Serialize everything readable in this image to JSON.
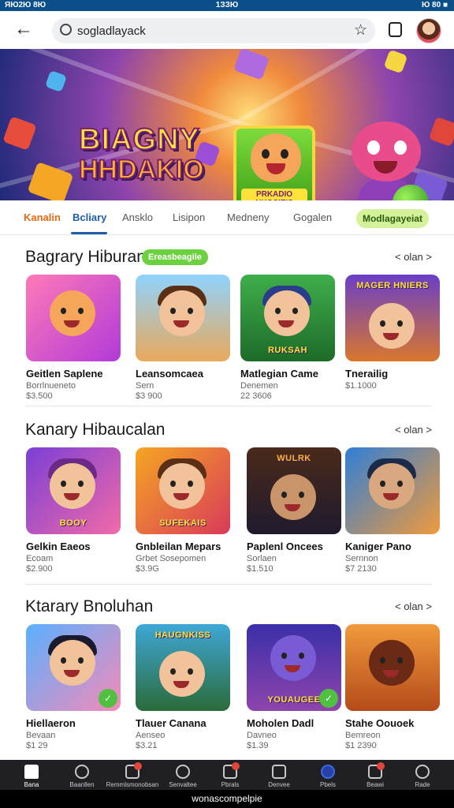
{
  "status": {
    "left": "ЯЮ2Ю 8Ю",
    "time": "1ЗЗЮ",
    "right": "Ю 80 ■"
  },
  "search": {
    "value": "sogladlayack"
  },
  "banner": {
    "title_line1": "BIAGNY",
    "title_line2": "HHDAKIO",
    "box_text": "PRKADIO NHOSIEIS"
  },
  "tabs": [
    {
      "label": "Kanalin"
    },
    {
      "label": "Bcliary"
    },
    {
      "label": "Ansklo"
    },
    {
      "label": "Lisipon"
    },
    {
      "label": "Medneny"
    },
    {
      "label": "Gogalen"
    }
  ],
  "tab_chip": "Modlagayeiat",
  "sections": [
    {
      "title": "Bagrary Hiburan",
      "badge": "Ereasbeagile",
      "more": "< olan >",
      "items": [
        {
          "name": "Geitlen Saplene",
          "sub": "Borrlnueneto",
          "price": "$3.500",
          "thumb_label": ""
        },
        {
          "name": "Leansomcaea",
          "sub": "Sern",
          "price": "$3 900",
          "thumb_label": ""
        },
        {
          "name": "Matlegian Came",
          "sub": "Denemen",
          "price": "22 3606",
          "thumb_label": "RUKSAH"
        },
        {
          "name": "Tnerailig",
          "sub": "",
          "price": "$1.1000",
          "thumb_label": "MAGER HNIERS"
        }
      ]
    },
    {
      "title": "Kanary Hibaucalan",
      "more": "< olan >",
      "items": [
        {
          "name": "Gelkin Eaeos",
          "sub": "Ecoam",
          "price": "$2.900",
          "thumb_label": "BOOY"
        },
        {
          "name": "Gnbleilan Mepars",
          "sub": "Grbet Sosepomen",
          "price": "$3.9G",
          "thumb_label": "SUFEKAIS"
        },
        {
          "name": "Paplenl Oncees",
          "sub": "Sorlaen",
          "price": "$1.510",
          "thumb_label": "WULRK"
        },
        {
          "name": "Kaniger Pano",
          "sub": "Sernnon",
          "price": "$7 2130",
          "thumb_label": ""
        }
      ]
    },
    {
      "title": "Ktarary Bnoluhan",
      "more": "< olan >",
      "items": [
        {
          "name": "Hiellaeron",
          "sub": "Bevaan",
          "price": "$1 29",
          "thumb_label": ""
        },
        {
          "name": "Tlauer Canana",
          "sub": "Aenseo",
          "price": "$3.21",
          "thumb_label": "HAUGNKISS"
        },
        {
          "name": "Moholen Dadl",
          "sub": "Davneo",
          "price": "$1.39",
          "thumb_label": "YOUAUGEE"
        },
        {
          "name": "Stahe Oouoek",
          "sub": "Bemreon",
          "price": "$1 2390",
          "thumb_label": ""
        }
      ]
    }
  ],
  "nav": [
    {
      "label": "Bana"
    },
    {
      "label": "Baanllen"
    },
    {
      "label": "Remmlsmonobsan"
    },
    {
      "label": "Senvaltee"
    },
    {
      "label": "Pbrals"
    },
    {
      "label": "Denvee"
    },
    {
      "label": "Pbels"
    },
    {
      "label": "Beawi"
    },
    {
      "label": "Rade"
    }
  ],
  "url": "wonascompelpie",
  "colors": {
    "accent": "#1c5fa8",
    "status_bar": "#0b4f8a",
    "chip": "#d4f29a",
    "badge": "#6bd13f",
    "nav_bg": "#1f1f24"
  }
}
